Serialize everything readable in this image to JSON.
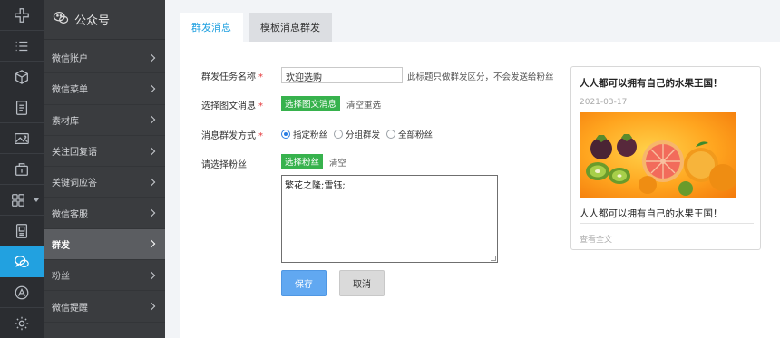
{
  "sidebar": {
    "header": "公众号",
    "items": [
      {
        "label": "微信账户"
      },
      {
        "label": "微信菜单"
      },
      {
        "label": "素材库"
      },
      {
        "label": "关注回复语"
      },
      {
        "label": "关键词应答"
      },
      {
        "label": "微信客服"
      },
      {
        "label": "群发"
      },
      {
        "label": "粉丝"
      },
      {
        "label": "微信提醒"
      }
    ]
  },
  "tabs": [
    {
      "label": "群发消息"
    },
    {
      "label": "模板消息群发"
    }
  ],
  "form": {
    "task_name_label": "群发任务名称",
    "task_name_value": "欢迎选购",
    "task_name_hint": "此标题只做群发区分，不会发送给粉丝",
    "select_news_label": "选择图文消息",
    "select_news_button": "选择图文消息",
    "select_news_clear": "清空重选",
    "send_mode_label": "消息群发方式",
    "send_mode_options": [
      "指定粉丝",
      "分组群发",
      "全部粉丝"
    ],
    "send_mode_selected": "指定粉丝",
    "fans_label": "请选择粉丝",
    "fans_button": "选择粉丝",
    "fans_clear": "清空",
    "fans_textarea": "繁花之隆;雪钰;",
    "required_mark": "*",
    "save_button": "保存",
    "cancel_button": "取消"
  },
  "preview": {
    "title": "人人都可以拥有自己的水果王国！",
    "date": "2021-03-17",
    "image": "fruit-image",
    "description": "人人都可以拥有自己的水果王国！",
    "read_more": "查看全文"
  },
  "colors": {
    "accent": "#22a1e0",
    "green": "#37b24d",
    "save": "#61a8f1",
    "required": "#e4393c"
  },
  "rail_icons": [
    "plus-cross-icon",
    "list-icon",
    "cube-icon",
    "document-icon",
    "image-icon",
    "briefcase-icon",
    "grid-icon",
    "template-icon",
    "wechat-icon",
    "compass-icon",
    "gear-icon"
  ]
}
